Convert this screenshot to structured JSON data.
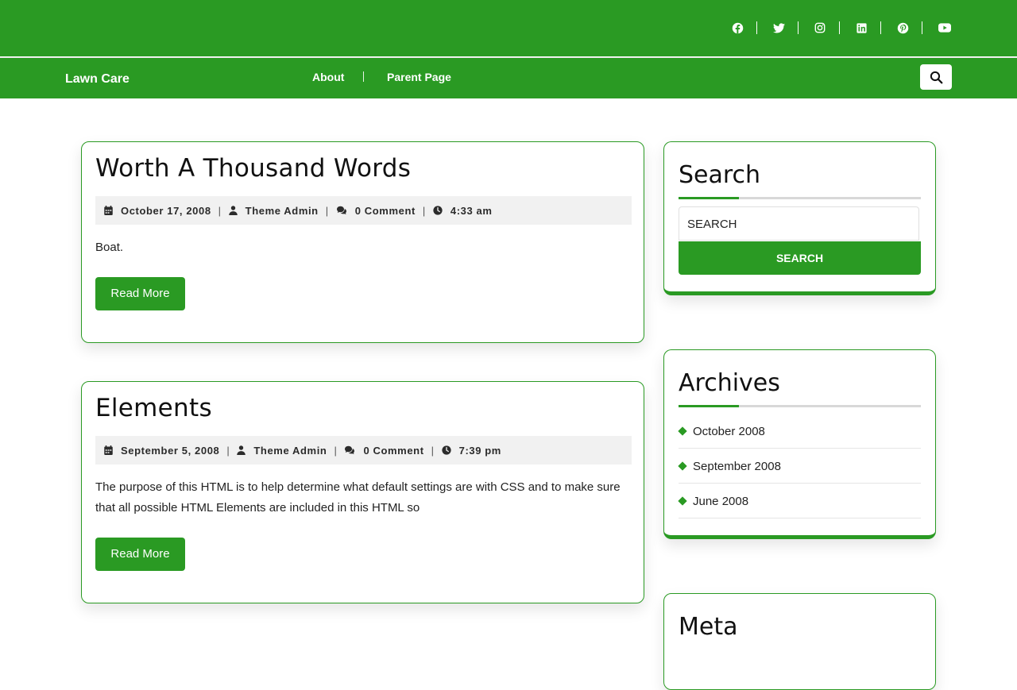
{
  "social": [
    "facebook-icon",
    "twitter-icon",
    "instagram-icon",
    "linkedin-icon",
    "pinterest-icon",
    "youtube-icon"
  ],
  "header": {
    "brand": "Lawn Care",
    "menu": [
      "About",
      "Parent Page"
    ]
  },
  "posts": [
    {
      "title": "Worth A Thousand Words",
      "date": "October 17, 2008",
      "author": "Theme Admin",
      "comments": "0 Comment",
      "time": "4:33 am",
      "excerpt": "Boat.",
      "read_more": "Read More"
    },
    {
      "title": "Elements",
      "date": "September 5, 2008",
      "author": "Theme Admin",
      "comments": "0 Comment",
      "time": "7:39 pm",
      "excerpt_line1": "The purpose of this HTML is to help determine what default settings are with CSS and to make sure",
      "excerpt_line2": "that all possible HTML Elements are included in this HTML so",
      "read_more": "Read More"
    }
  ],
  "sidebar": {
    "search": {
      "title": "Search",
      "placeholder": "SEARCH",
      "button": "SEARCH"
    },
    "archives": {
      "title": "Archives",
      "items": [
        "October 2008",
        "September 2008",
        "June 2008"
      ]
    },
    "meta": {
      "title": "Meta"
    }
  },
  "colors": {
    "brand_green": "#2a9a23"
  }
}
